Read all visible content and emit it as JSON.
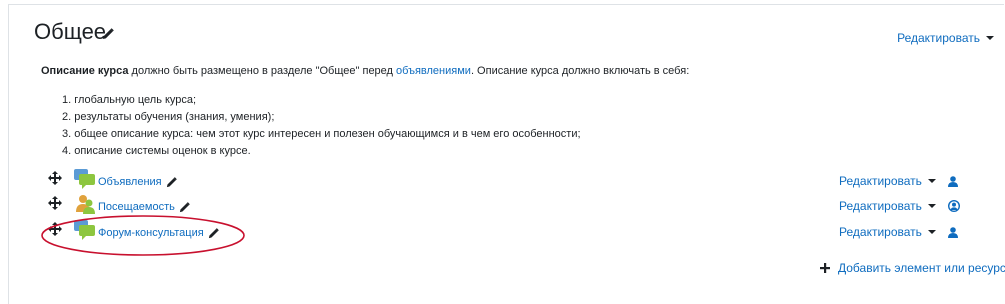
{
  "section": {
    "title": "Общее",
    "edit_label": "Редактировать"
  },
  "summary": {
    "bold_part": "Описание курса",
    "text_part1": " должно быть размещено в разделе \"Общее\" перед ",
    "link_part": "объявлениями",
    "text_part2": ". Описание курса должно включать в себя:"
  },
  "goals": [
    "1. глобальную цель курса;",
    "2. результаты обучения (знания, умения);",
    "3. общее описание курса: чем этот курс интересен и полезен обучающимся и в чем его особенности;",
    "4. описание системы оценок в курсе."
  ],
  "activities": [
    {
      "name": "Объявления",
      "icon": "forum-icon",
      "edit_label": "Редактировать",
      "access_icon": "user-icon"
    },
    {
      "name": "Посещаемость",
      "icon": "attendance-icon",
      "edit_label": "Редактировать",
      "access_icon": "user-circle-icon"
    },
    {
      "name": "Форум-консультация",
      "icon": "forum-icon",
      "edit_label": "Редактировать",
      "access_icon": "user-icon"
    }
  ],
  "add_label": "Добавить элемент или ресурс",
  "colors": {
    "link": "#0f6cbf",
    "highlight": "#c8102e"
  }
}
